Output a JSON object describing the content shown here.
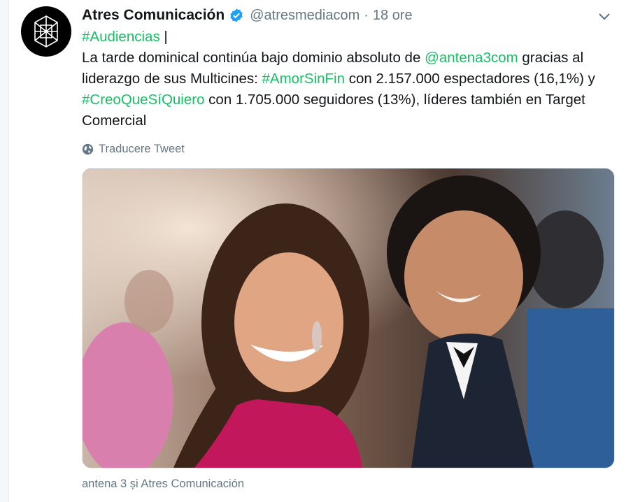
{
  "tweet": {
    "display_name": "Atres Comunicación",
    "verified_icon": "verified-badge-icon",
    "handle": "@atresmediacom",
    "separator": "·",
    "time": "18 ore",
    "menu_icon": "chevron-down-icon",
    "avatar_icon": "atresmedia-logo-icon",
    "text": {
      "hashtag_1": "#Audiencias",
      "after_hashtag_1": " |",
      "l2_a": "La tarde dominical continúa bajo dominio absoluto de ",
      "mention_1": "@antena3com",
      "l2_b": " gracias al",
      "l3_a": "liderazgo de sus Multicines: ",
      "hashtag_2": "#AmorSinFin",
      "l3_b": " con 2.157.000 espectadores (16,1%) y",
      "hashtag_3": "#CreoQueSíQuiero",
      "l4_b": " con 1.705.000 seguidores (13%), líderes también en Target",
      "l5": "Comercial"
    },
    "translate_label": "Traducere Tweet",
    "translate_icon": "globe-icon",
    "media_alt": "photo",
    "footer": "antena 3 și Atres Comunicación"
  },
  "colors": {
    "link": "#17bf63",
    "verified": "#1da1f2",
    "muted": "#657786",
    "text": "#14171a"
  }
}
